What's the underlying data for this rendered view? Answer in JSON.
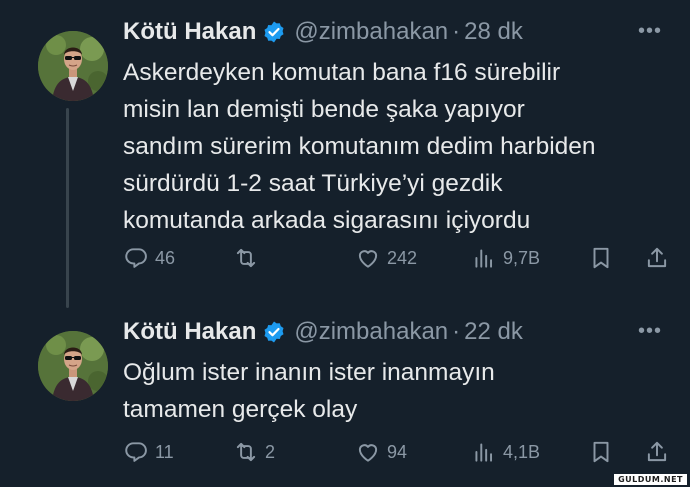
{
  "tweets": [
    {
      "name": "Kötü Hakan",
      "handle": "@zimbahakan",
      "dot": "·",
      "time": "28 dk",
      "more": "•••",
      "text_lines": [
        "Askerdeyken komutan bana f16 sürebilir",
        "misin lan demişti bende şaka yapıyor",
        "sandım sürerim komutanım dedim harbiden",
        "sürdürdü 1-2 saat Türkiye’yi gezdik",
        "komutanda arkada sigarasını içiyordu"
      ],
      "replies": "46",
      "retweets": "",
      "likes": "242",
      "views": "9,7B"
    },
    {
      "name": "Kötü Hakan",
      "handle": "@zimbahakan",
      "dot": "·",
      "time": "22 dk",
      "more": "•••",
      "text_lines": [
        "Oğlum ister inanın ister inanmayın",
        "tamamen gerçek olay"
      ],
      "replies": "11",
      "retweets": "2",
      "likes": "94",
      "views": "4,1B"
    }
  ],
  "icons": {
    "verified": "verified-badge-icon",
    "reply": "reply-icon",
    "retweet": "retweet-icon",
    "like": "heart-icon",
    "views": "views-icon",
    "bookmark": "bookmark-icon",
    "share": "share-icon"
  },
  "colors": {
    "background": "#15202b",
    "text": "#e7e9ea",
    "muted": "#8b98a5",
    "verified": "#1d9bf0"
  },
  "watermark": "GULDUM.NET"
}
